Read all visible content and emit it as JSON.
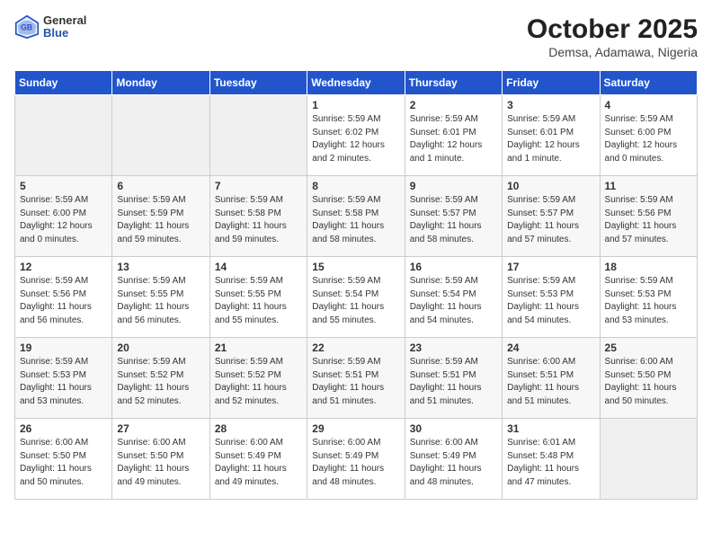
{
  "header": {
    "logo_general": "General",
    "logo_blue": "Blue",
    "month": "October 2025",
    "location": "Demsa, Adamawa, Nigeria"
  },
  "weekdays": [
    "Sunday",
    "Monday",
    "Tuesday",
    "Wednesday",
    "Thursday",
    "Friday",
    "Saturday"
  ],
  "weeks": [
    [
      {
        "day": "",
        "sunrise": "",
        "sunset": "",
        "daylight": ""
      },
      {
        "day": "",
        "sunrise": "",
        "sunset": "",
        "daylight": ""
      },
      {
        "day": "",
        "sunrise": "",
        "sunset": "",
        "daylight": ""
      },
      {
        "day": "1",
        "sunrise": "Sunrise: 5:59 AM",
        "sunset": "Sunset: 6:02 PM",
        "daylight": "Daylight: 12 hours and 2 minutes."
      },
      {
        "day": "2",
        "sunrise": "Sunrise: 5:59 AM",
        "sunset": "Sunset: 6:01 PM",
        "daylight": "Daylight: 12 hours and 1 minute."
      },
      {
        "day": "3",
        "sunrise": "Sunrise: 5:59 AM",
        "sunset": "Sunset: 6:01 PM",
        "daylight": "Daylight: 12 hours and 1 minute."
      },
      {
        "day": "4",
        "sunrise": "Sunrise: 5:59 AM",
        "sunset": "Sunset: 6:00 PM",
        "daylight": "Daylight: 12 hours and 0 minutes."
      }
    ],
    [
      {
        "day": "5",
        "sunrise": "Sunrise: 5:59 AM",
        "sunset": "Sunset: 6:00 PM",
        "daylight": "Daylight: 12 hours and 0 minutes."
      },
      {
        "day": "6",
        "sunrise": "Sunrise: 5:59 AM",
        "sunset": "Sunset: 5:59 PM",
        "daylight": "Daylight: 11 hours and 59 minutes."
      },
      {
        "day": "7",
        "sunrise": "Sunrise: 5:59 AM",
        "sunset": "Sunset: 5:58 PM",
        "daylight": "Daylight: 11 hours and 59 minutes."
      },
      {
        "day": "8",
        "sunrise": "Sunrise: 5:59 AM",
        "sunset": "Sunset: 5:58 PM",
        "daylight": "Daylight: 11 hours and 58 minutes."
      },
      {
        "day": "9",
        "sunrise": "Sunrise: 5:59 AM",
        "sunset": "Sunset: 5:57 PM",
        "daylight": "Daylight: 11 hours and 58 minutes."
      },
      {
        "day": "10",
        "sunrise": "Sunrise: 5:59 AM",
        "sunset": "Sunset: 5:57 PM",
        "daylight": "Daylight: 11 hours and 57 minutes."
      },
      {
        "day": "11",
        "sunrise": "Sunrise: 5:59 AM",
        "sunset": "Sunset: 5:56 PM",
        "daylight": "Daylight: 11 hours and 57 minutes."
      }
    ],
    [
      {
        "day": "12",
        "sunrise": "Sunrise: 5:59 AM",
        "sunset": "Sunset: 5:56 PM",
        "daylight": "Daylight: 11 hours and 56 minutes."
      },
      {
        "day": "13",
        "sunrise": "Sunrise: 5:59 AM",
        "sunset": "Sunset: 5:55 PM",
        "daylight": "Daylight: 11 hours and 56 minutes."
      },
      {
        "day": "14",
        "sunrise": "Sunrise: 5:59 AM",
        "sunset": "Sunset: 5:55 PM",
        "daylight": "Daylight: 11 hours and 55 minutes."
      },
      {
        "day": "15",
        "sunrise": "Sunrise: 5:59 AM",
        "sunset": "Sunset: 5:54 PM",
        "daylight": "Daylight: 11 hours and 55 minutes."
      },
      {
        "day": "16",
        "sunrise": "Sunrise: 5:59 AM",
        "sunset": "Sunset: 5:54 PM",
        "daylight": "Daylight: 11 hours and 54 minutes."
      },
      {
        "day": "17",
        "sunrise": "Sunrise: 5:59 AM",
        "sunset": "Sunset: 5:53 PM",
        "daylight": "Daylight: 11 hours and 54 minutes."
      },
      {
        "day": "18",
        "sunrise": "Sunrise: 5:59 AM",
        "sunset": "Sunset: 5:53 PM",
        "daylight": "Daylight: 11 hours and 53 minutes."
      }
    ],
    [
      {
        "day": "19",
        "sunrise": "Sunrise: 5:59 AM",
        "sunset": "Sunset: 5:53 PM",
        "daylight": "Daylight: 11 hours and 53 minutes."
      },
      {
        "day": "20",
        "sunrise": "Sunrise: 5:59 AM",
        "sunset": "Sunset: 5:52 PM",
        "daylight": "Daylight: 11 hours and 52 minutes."
      },
      {
        "day": "21",
        "sunrise": "Sunrise: 5:59 AM",
        "sunset": "Sunset: 5:52 PM",
        "daylight": "Daylight: 11 hours and 52 minutes."
      },
      {
        "day": "22",
        "sunrise": "Sunrise: 5:59 AM",
        "sunset": "Sunset: 5:51 PM",
        "daylight": "Daylight: 11 hours and 51 minutes."
      },
      {
        "day": "23",
        "sunrise": "Sunrise: 5:59 AM",
        "sunset": "Sunset: 5:51 PM",
        "daylight": "Daylight: 11 hours and 51 minutes."
      },
      {
        "day": "24",
        "sunrise": "Sunrise: 6:00 AM",
        "sunset": "Sunset: 5:51 PM",
        "daylight": "Daylight: 11 hours and 51 minutes."
      },
      {
        "day": "25",
        "sunrise": "Sunrise: 6:00 AM",
        "sunset": "Sunset: 5:50 PM",
        "daylight": "Daylight: 11 hours and 50 minutes."
      }
    ],
    [
      {
        "day": "26",
        "sunrise": "Sunrise: 6:00 AM",
        "sunset": "Sunset: 5:50 PM",
        "daylight": "Daylight: 11 hours and 50 minutes."
      },
      {
        "day": "27",
        "sunrise": "Sunrise: 6:00 AM",
        "sunset": "Sunset: 5:50 PM",
        "daylight": "Daylight: 11 hours and 49 minutes."
      },
      {
        "day": "28",
        "sunrise": "Sunrise: 6:00 AM",
        "sunset": "Sunset: 5:49 PM",
        "daylight": "Daylight: 11 hours and 49 minutes."
      },
      {
        "day": "29",
        "sunrise": "Sunrise: 6:00 AM",
        "sunset": "Sunset: 5:49 PM",
        "daylight": "Daylight: 11 hours and 48 minutes."
      },
      {
        "day": "30",
        "sunrise": "Sunrise: 6:00 AM",
        "sunset": "Sunset: 5:49 PM",
        "daylight": "Daylight: 11 hours and 48 minutes."
      },
      {
        "day": "31",
        "sunrise": "Sunrise: 6:01 AM",
        "sunset": "Sunset: 5:48 PM",
        "daylight": "Daylight: 11 hours and 47 minutes."
      },
      {
        "day": "",
        "sunrise": "",
        "sunset": "",
        "daylight": ""
      }
    ]
  ]
}
